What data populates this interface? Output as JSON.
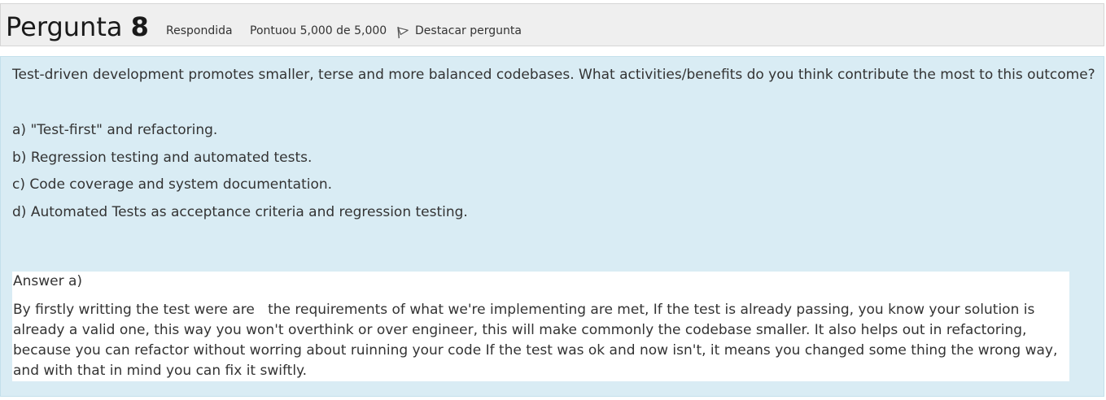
{
  "header": {
    "question_word": "Pergunta",
    "question_number": "8",
    "state": "Respondida",
    "grade": "Pontuou 5,000 de 5,000",
    "flag_label": "Destacar pergunta"
  },
  "question": {
    "prompt": "Test-driven development promotes smaller, terse and more balanced codebases. What activities/benefits do you think contribute the most to this outcome?",
    "options": [
      "a) \"Test-first\" and refactoring.",
      "b) Regression testing and automated tests.",
      "c) Code coverage and system documentation.",
      "d) Automated Tests as acceptance criteria and regression testing."
    ]
  },
  "answer": {
    "label": "Answer a)",
    "text": "By firstly writting the test were are   the requirements of what we're implementing are met, If the test is already passing, you know your solution is already a valid one, this way you won't overthink or over engineer, this will make commonly the codebase smaller. It also helps out in refactoring, because you can refactor without worring about ruinning your code If the test was ok and now isn't, it means you changed some thing the wrong way, and with that in mind you can fix it swiftly."
  },
  "icons": {
    "flag": "flag-icon"
  },
  "colors": {
    "info_background": "#efefef",
    "content_background": "#d9ecf4",
    "answer_background": "#ffffff"
  }
}
